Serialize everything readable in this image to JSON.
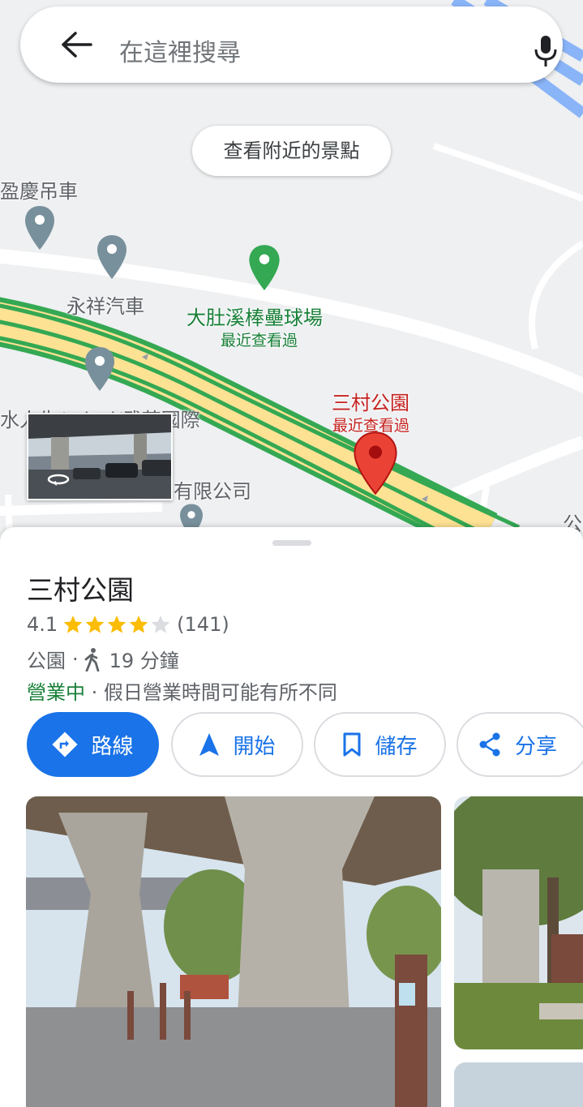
{
  "search": {
    "placeholder": "在這裡搜尋"
  },
  "map": {
    "explore_chip": "查看附近的景點",
    "labels": {
      "cable_car": "盈慶吊車",
      "yongxiang": "永祥汽車",
      "ballpark": "大肚溪棒壘球場",
      "ballpark_sub": "最近查看過",
      "selected": "三村公園",
      "selected_sub": "最近查看過",
      "intl": "水人生/misci/武芸國際",
      "company": "有限公司",
      "edge": "公"
    }
  },
  "place": {
    "name": "三村公園",
    "rating": "4.1",
    "rating_fraction": 0.82,
    "reviews": "(141)",
    "type": "公園",
    "dot": "·",
    "walk_time": "19 分鐘",
    "status": "營業中",
    "status_note": "· 假日營業時間可能有所不同"
  },
  "actions": {
    "directions": "路線",
    "start": "開始",
    "save": "儲存",
    "share": "分享"
  },
  "colors": {
    "accent": "#1a73e8",
    "open_green": "#188038",
    "pin_red": "#ea4335",
    "star": "#fbbc04"
  }
}
